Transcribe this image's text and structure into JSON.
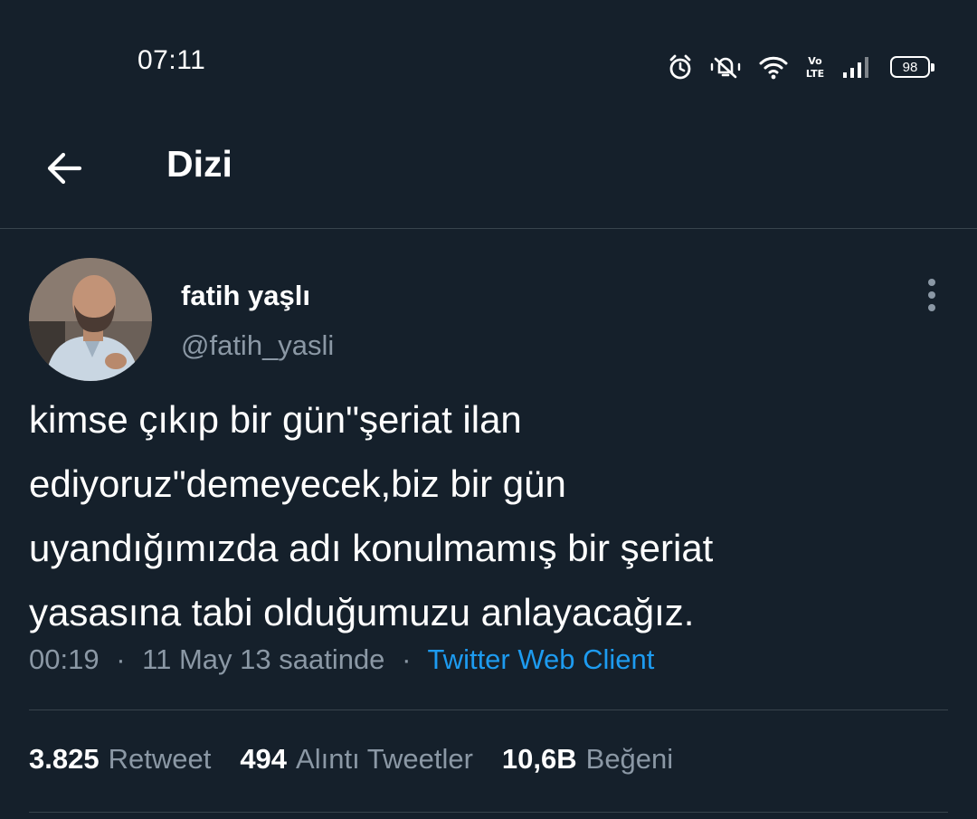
{
  "status_bar": {
    "time": "07:11",
    "battery": "98",
    "icons": [
      "alarm-icon",
      "mute-vibrate-icon",
      "wifi-icon",
      "volte-icon",
      "signal-icon",
      "battery-icon"
    ]
  },
  "header": {
    "title": "Dizi",
    "back_icon": "arrow-left-icon"
  },
  "tweet": {
    "display_name": "fatih yaşlı",
    "handle": "@fatih_yasli",
    "text": "kimse çıkıp bir gün\"şeriat ilan\nediyoruz\"demeyecek,biz bir gün\nuyandığımızda adı konulmamış bir şeriat\nyasasına tabi olduğumuzu anlayacağız.",
    "time": "00:19",
    "date": "11 May 13 saatinde",
    "separator": "·",
    "client": "Twitter Web Client"
  },
  "stats": {
    "retweets": {
      "count": "3.825",
      "label": "Retweet"
    },
    "quotes": {
      "count": "494",
      "label": "Alıntı Tweetler"
    },
    "likes": {
      "count": "10,6B",
      "label": "Beğeni"
    }
  },
  "colors": {
    "background": "#15202b",
    "divider": "#38444d",
    "secondary_text": "#8b98a5",
    "link": "#1d9bf0"
  }
}
